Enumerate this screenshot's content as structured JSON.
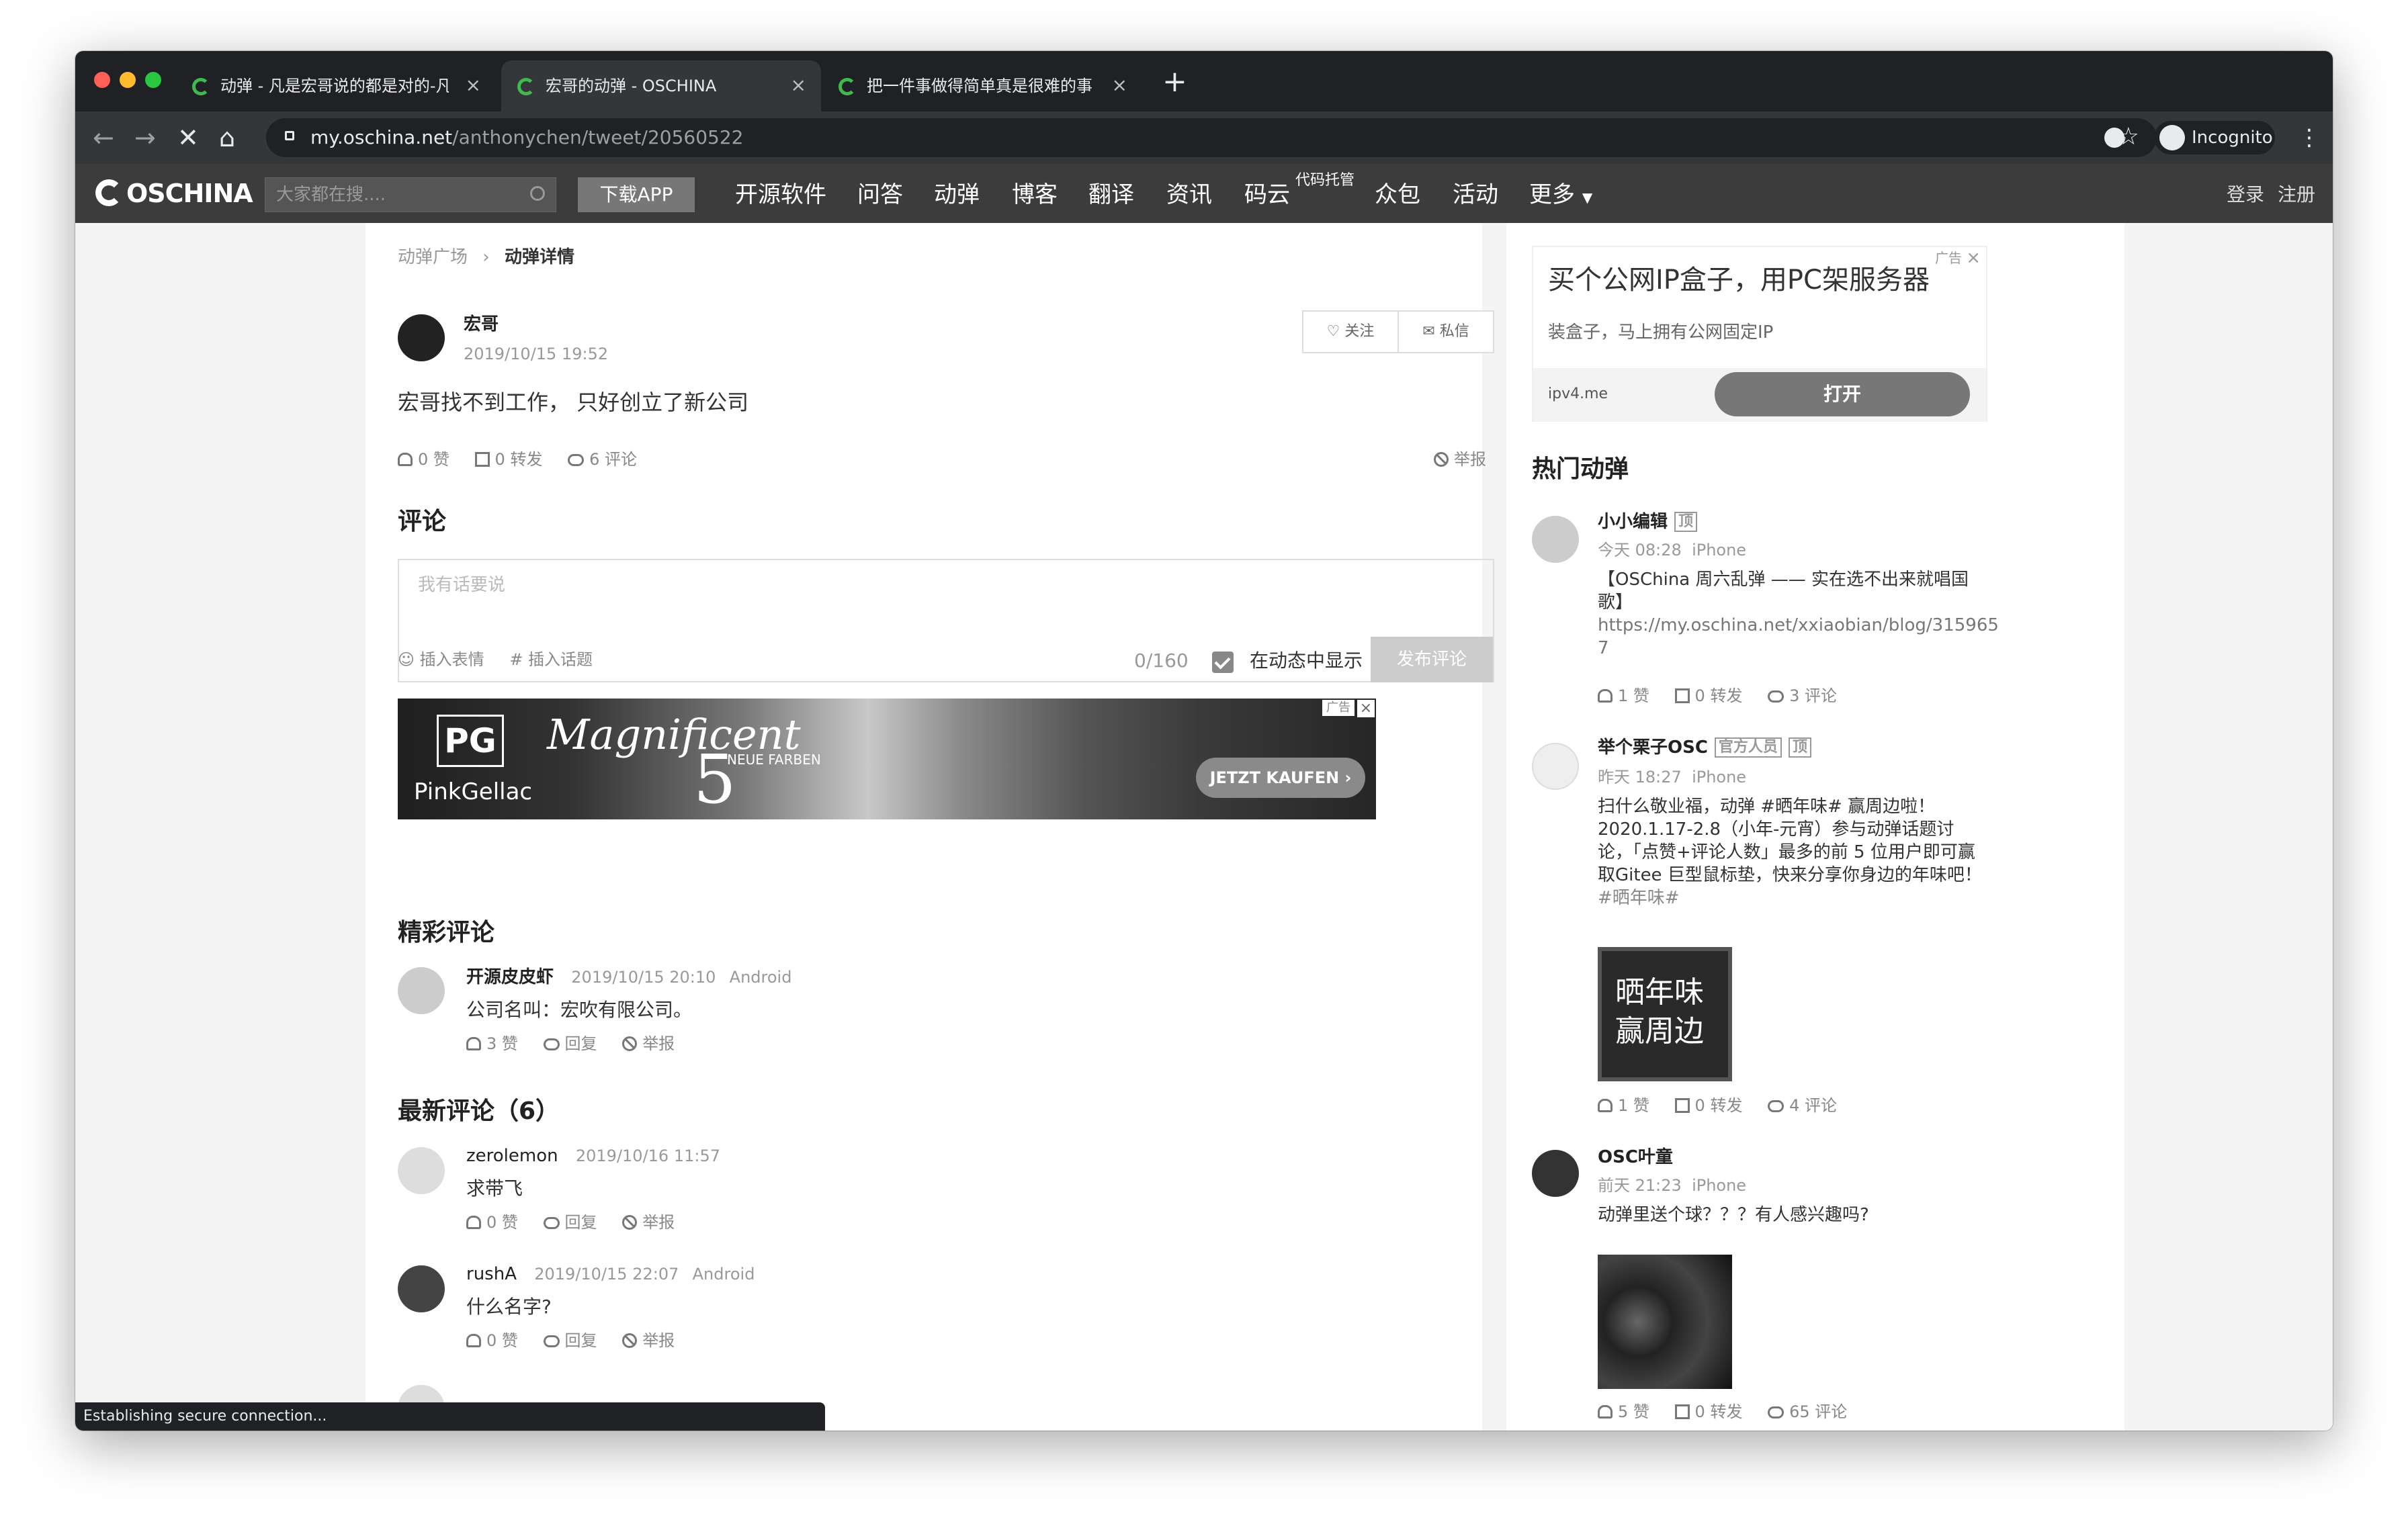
{
  "browser": {
    "tabs": [
      {
        "title": "动弹 - 凡是宏哥说的都是对的-凡",
        "active": false
      },
      {
        "title": "宏哥的动弹 - OSCHINA",
        "active": true
      },
      {
        "title": "把一件事做得简单真是很难的事",
        "active": false
      }
    ],
    "url_host": "my.oschina.net",
    "url_path": "/anthonychen/tweet/20560522",
    "profile_label": "Incognito",
    "status_text": "Establishing secure connection..."
  },
  "site": {
    "logo": "OSCHINA",
    "search_placeholder": "大家都在搜....",
    "download_app": "下载APP",
    "menu": [
      "开源软件",
      "问答",
      "动弹",
      "博客",
      "翻译",
      "资讯",
      "码云",
      "众包",
      "活动",
      "更多"
    ],
    "menu_superscript": "代码托管",
    "login": "登录",
    "register": "注册"
  },
  "breadcrumb": {
    "parent": "动弹广场",
    "current": "动弹详情"
  },
  "tweet": {
    "author": "宏哥",
    "time": "2019/10/15 19:52",
    "follow": "关注",
    "message": "私信",
    "content": "宏哥找不到工作， 只好创立了新公司",
    "likes": "0 赞",
    "forwards": "0 转发",
    "comments": "6 评论",
    "report": "举报"
  },
  "comment_form": {
    "heading": "评论",
    "placeholder": "我有话要说",
    "emoji": "插入表情",
    "topic": "插入话题",
    "counter": "0/160",
    "show_in_feed": "在动态中显示",
    "submit": "发布评论"
  },
  "banner_ad": {
    "brand": "PinkGellac",
    "logo": "PG",
    "title": "Magnificent",
    "number": "5",
    "sub": "NEUE FARBEN",
    "cta": "JETZT KAUFEN ›",
    "ad_label": "广告"
  },
  "featured": {
    "heading": "精彩评论",
    "items": [
      {
        "name": "开源皮皮虾",
        "time": "2019/10/15 20:10",
        "device": "Android",
        "text": "公司名叫：宏吹有限公司。",
        "likes": "3 赞",
        "reply": "回复",
        "report": "举报"
      }
    ]
  },
  "latest": {
    "heading": "最新评论（6）",
    "items": [
      {
        "name": "zerolemon",
        "time": "2019/10/16 11:57",
        "device": "",
        "text": "求带飞",
        "likes": "0 赞",
        "reply": "回复",
        "report": "举报"
      },
      {
        "name": "rushA",
        "time": "2019/10/15 22:07",
        "device": "Android",
        "text": "什么名字?",
        "likes": "0 赞",
        "reply": "回复",
        "report": "举报"
      }
    ]
  },
  "side_ad": {
    "title": "买个公网IP盒子，用PC架服务器",
    "subtitle": "装盒子，马上拥有公网固定IP",
    "domain": "ipv4.me",
    "button": "打开",
    "ad_label": "广告"
  },
  "hot": {
    "heading": "热门动弹",
    "items": [
      {
        "name": "小小编辑",
        "badges": [
          "顶"
        ],
        "time": "今天 08:28",
        "device": "iPhone",
        "lines": [
          "【OSChina 周六乱弹 —— 实在选不出来就唱国",
          "歌】",
          "https://my.oschina.net/xxiaobian/blog/315965",
          "7"
        ],
        "likes": "1 赞",
        "forwards": "0 转发",
        "comments": "3 评论"
      },
      {
        "name": "举个栗子OSC",
        "badges": [
          "官方人员",
          "顶"
        ],
        "time": "昨天 18:27",
        "device": "iPhone",
        "lines": [
          "扫什么敬业福，动弹 #晒年味# 赢周边啦！",
          "2020.1.17-2.8（小年-元宵）参与动弹话题讨",
          "论，「点赞+评论人数」最多的前 5 位用户即可赢",
          "取Gitee 巨型鼠标垫，快来分享你身边的年味吧！",
          "#晒年味#"
        ],
        "image_text": [
          "晒年味",
          "赢周边"
        ],
        "likes": "1 赞",
        "forwards": "0 转发",
        "comments": "4 评论"
      },
      {
        "name": "OSC叶童",
        "badges": [],
        "time": "前天 21:23",
        "device": "iPhone",
        "lines": [
          "动弹里送个球？？？有人感兴趣吗?"
        ],
        "likes": "5 赞",
        "forwards": "0 转发",
        "comments": "65 评论"
      }
    ]
  }
}
